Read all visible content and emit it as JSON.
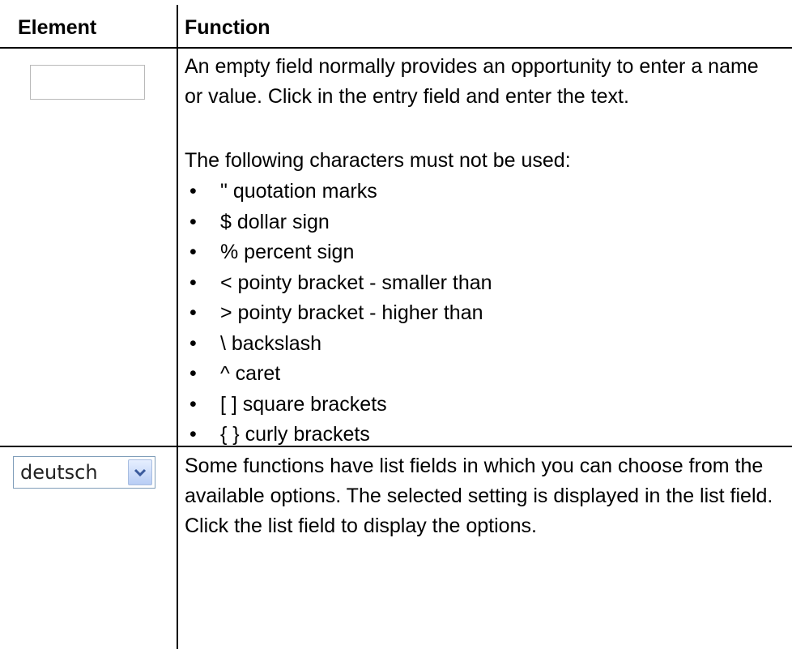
{
  "header": {
    "element": "Element",
    "function": "Function"
  },
  "rows": [
    {
      "element": {
        "type": "entry-field",
        "value": ""
      },
      "paragraphs": [
        "An empty field normally provides an opportunity to enter a name or value. Click in the entry field and enter the text.",
        "The following characters must not be used:"
      ],
      "bullets": [
        "\" quotation marks",
        "$ dollar sign",
        "% percent sign",
        "< pointy bracket - smaller than",
        "> pointy bracket - higher than",
        "\\ backslash",
        "^ caret",
        "[ ] square brackets",
        "{ } curly brackets"
      ]
    },
    {
      "element": {
        "type": "list-field",
        "value": "deutsch",
        "icon": "chevron-down-icon"
      },
      "paragraphs": [
        "Some functions have list fields in which you can choose from the available options. The selected setting is displayed in the list field. Click the list field to display the options."
      ]
    }
  ]
}
